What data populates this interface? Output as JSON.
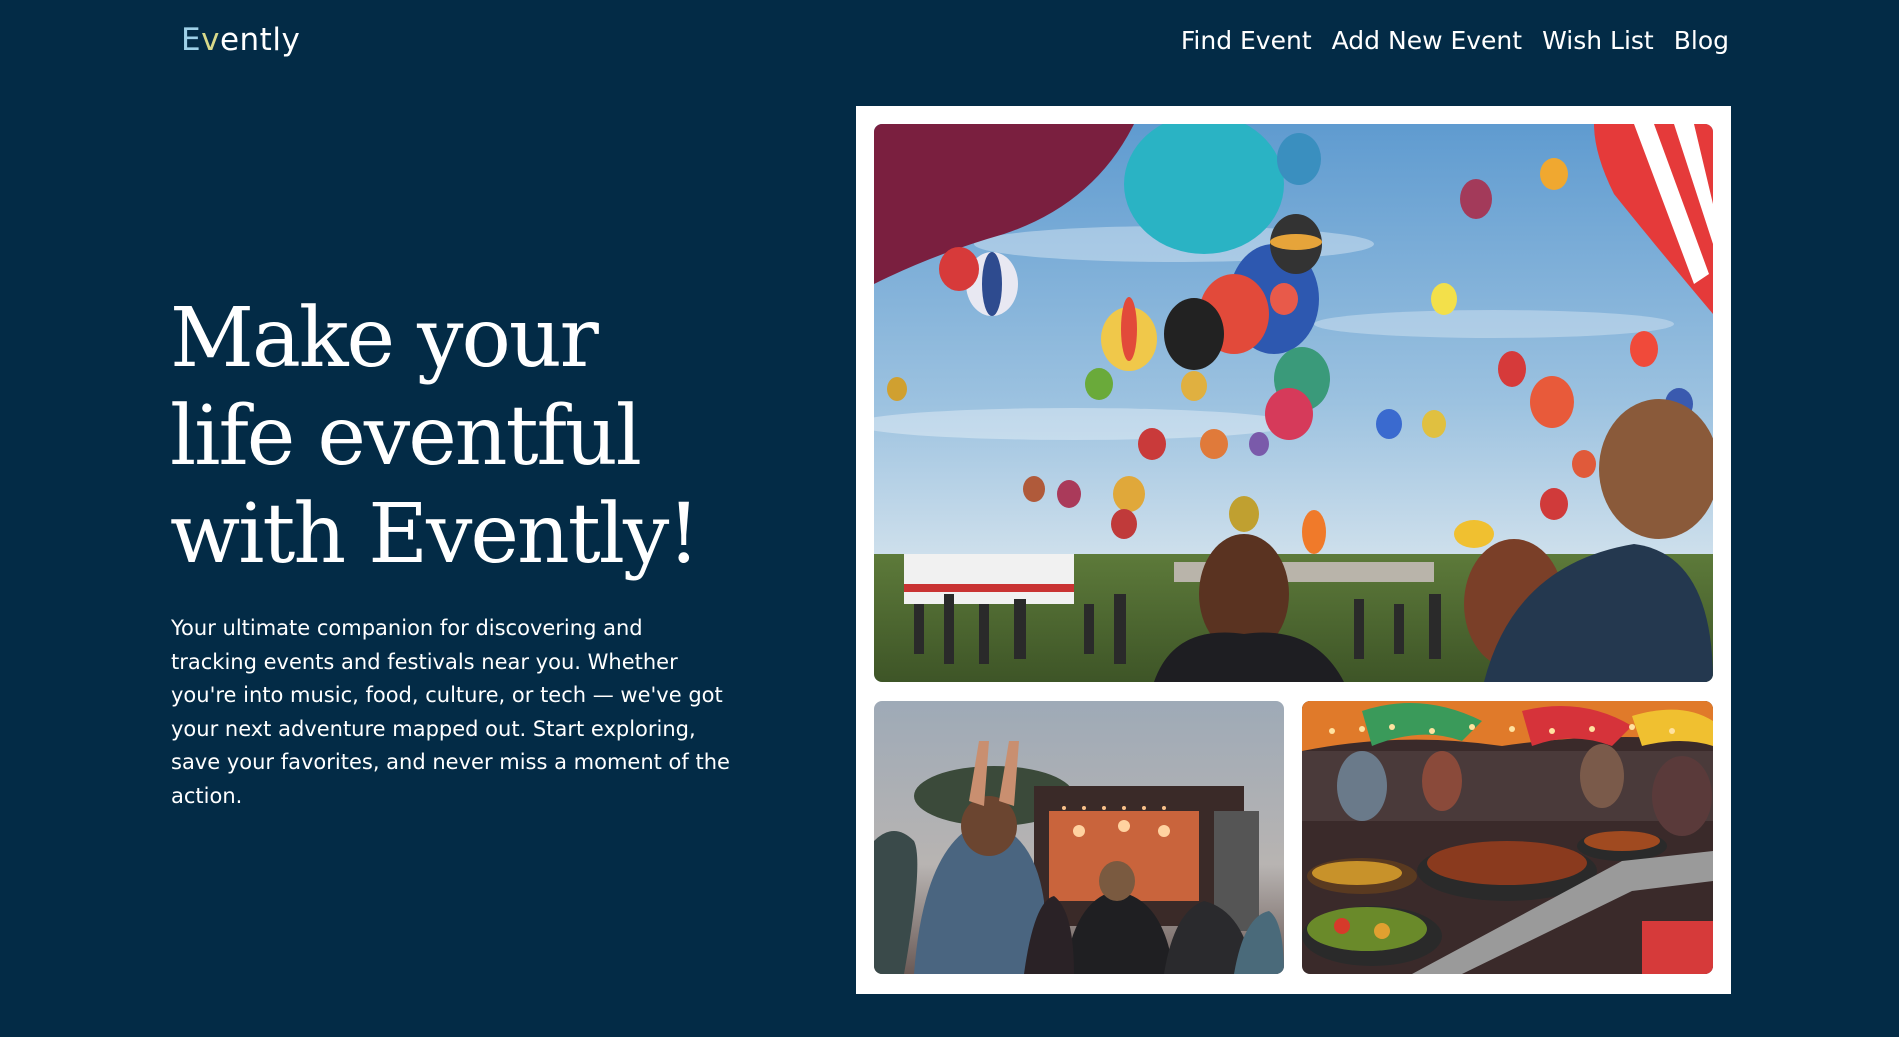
{
  "header": {
    "logo_part1": "E",
    "logo_part2": "v",
    "logo_part3": "ently"
  },
  "nav": {
    "items": [
      {
        "label": "Find Event"
      },
      {
        "label": "Add New Event"
      },
      {
        "label": "Wish List"
      },
      {
        "label": "Blog"
      }
    ]
  },
  "hero": {
    "title_line1": "Make your",
    "title_line2": "life eventful",
    "title_line3": "with Evently!",
    "description": "Your ultimate companion for discovering and tracking events and festivals near you. Whether you're into music, food, culture, or tech — we've got your next adventure mapped out. Start exploring, save your favorites, and never miss a moment of the action."
  },
  "colors": {
    "background": "#032b46",
    "text": "#ffffff",
    "frame": "#ffffff"
  }
}
